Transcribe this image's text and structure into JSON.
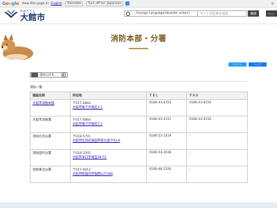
{
  "translate_bar": {
    "google": [
      "G",
      "o",
      "o",
      "g",
      "l",
      "e"
    ],
    "view_page_in": "View this page in:",
    "language": "English",
    "translate_button": "Translate",
    "turn_off": "Turn off for: Japanese"
  },
  "header": {
    "logo_kana": "おおだてし",
    "logo_kanji": "大館市",
    "lang_select_label": "Foreign Language(disaster action)",
    "search_placeholder": "サイト内記事を検索",
    "search_button": "検索",
    "menu_button": "メニュー"
  },
  "banner": {
    "title": "消防本部・分署"
  },
  "share": {
    "twitter": "ツイート",
    "facebook": "シェア"
  },
  "read_aloud": {
    "label": "読み上げる"
  },
  "section": {
    "title": "消防一覧"
  },
  "table": {
    "headers": [
      "施設名称",
      "所在地",
      "ＴＥＬ",
      "ＦＡＸ"
    ],
    "rows": [
      {
        "name": "大館市消防本部",
        "name_link": true,
        "postal": "〒017-0864",
        "address": "大館市根下戸新町1-1",
        "tel": "0186-43-4152",
        "fax": "0186-43-4150"
      },
      {
        "name": "大館市消防署",
        "name_link": false,
        "postal": "〒017-0864",
        "address": "大館市根下戸新町1-1",
        "tel": "0186-43-4151",
        "fax": "0186-43-4150"
      },
      {
        "name": "消防比内分署",
        "name_link": false,
        "postal": "〒018-5701",
        "address": "大館市比内町扇田字新大堤下93-6",
        "tel": "0186-55-1419",
        "fax": "-"
      },
      {
        "name": "消防田代分署",
        "name_link": false,
        "postal": "〒018-3505",
        "address": "大館市早口字城岱38-51",
        "tel": "0186-54-3038",
        "fax": "-"
      },
      {
        "name": "消防東北分署",
        "name_link": false,
        "postal": "〒017-0012",
        "address": "大館市釈迦内字稲荷山下284",
        "tel": "0186-48-2320",
        "fax": "-"
      }
    ]
  },
  "colors": {
    "title_brown": "#7a5a1a",
    "link_blue": "#1a0dab",
    "logo_navy": "#1e3a6e"
  }
}
